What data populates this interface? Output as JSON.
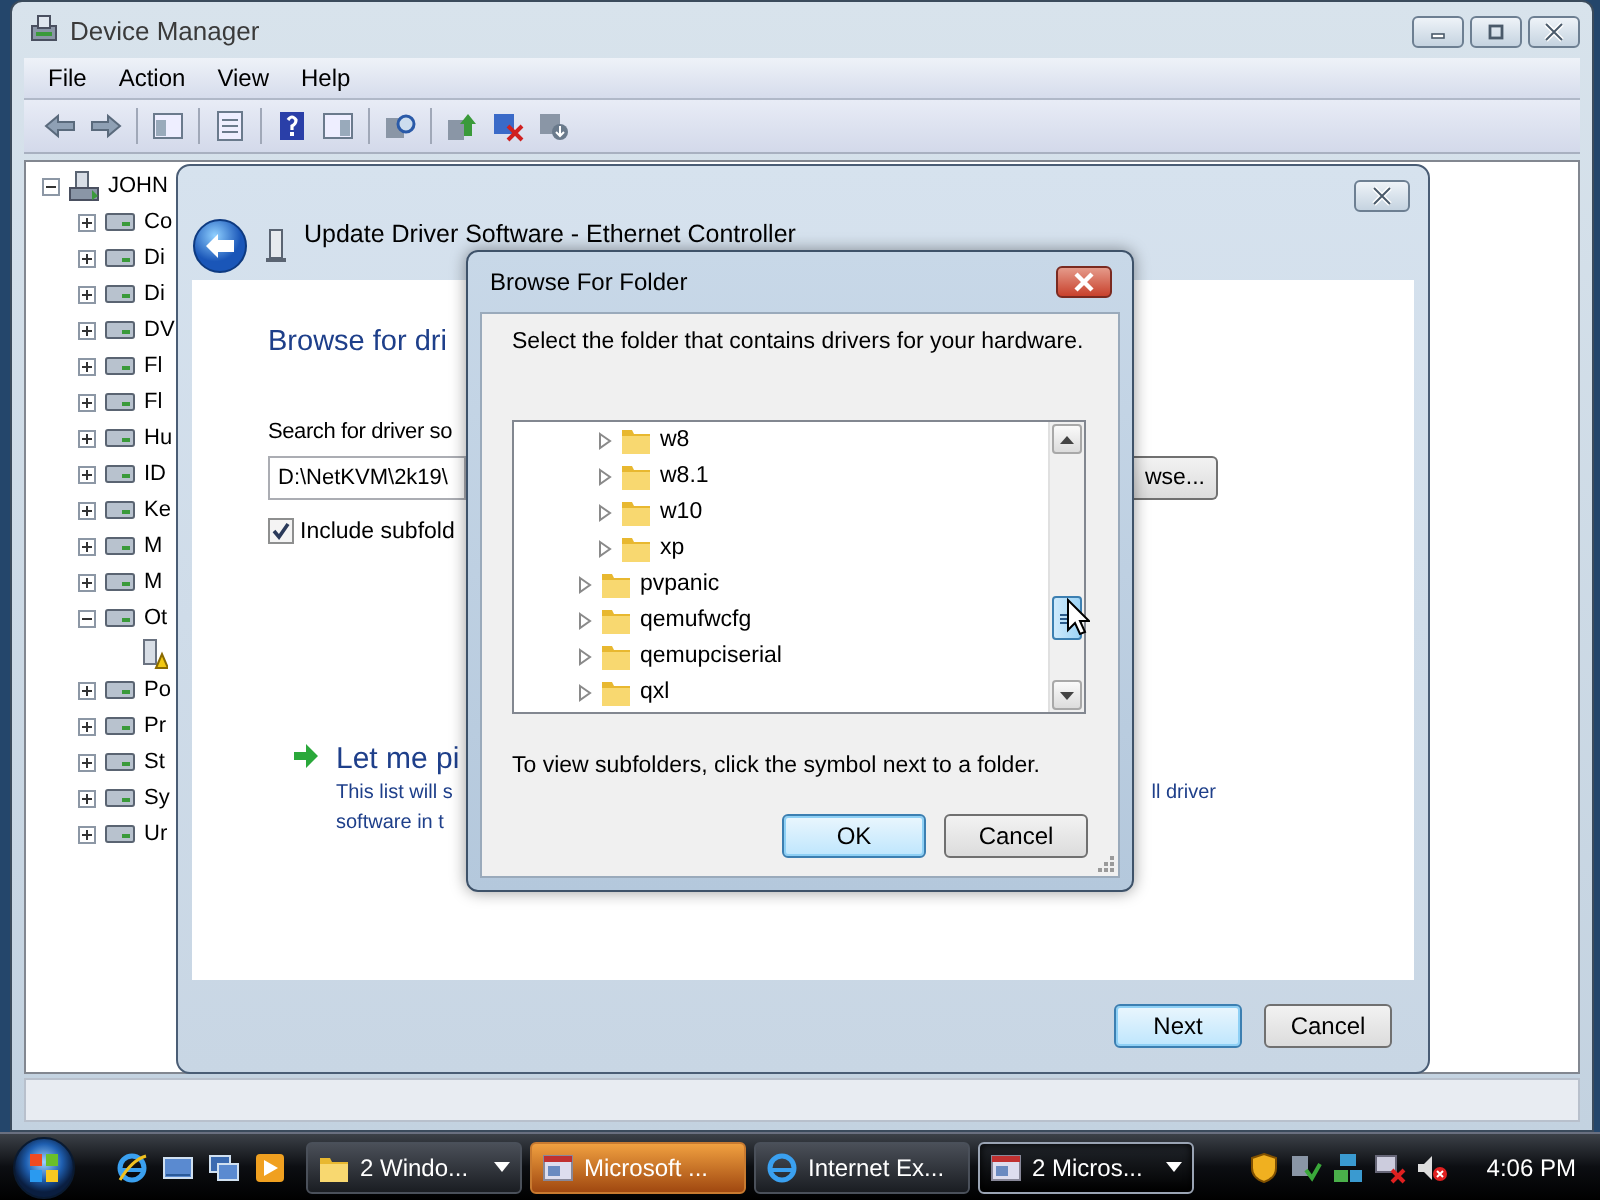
{
  "device_manager": {
    "title": "Device Manager",
    "menu": [
      "File",
      "Action",
      "View",
      "Help"
    ],
    "tree": {
      "label": "JOHN",
      "expanded": true,
      "children": [
        {
          "label": "Co",
          "expanded": false
        },
        {
          "label": "Di",
          "expanded": false
        },
        {
          "label": "Di",
          "expanded": false
        },
        {
          "label": "DV",
          "expanded": false
        },
        {
          "label": "Fl",
          "expanded": false
        },
        {
          "label": "Fl",
          "expanded": false
        },
        {
          "label": "Hu",
          "expanded": false
        },
        {
          "label": "ID",
          "expanded": false
        },
        {
          "label": "Ke",
          "expanded": false
        },
        {
          "label": "M",
          "expanded": false
        },
        {
          "label": "M",
          "expanded": false
        },
        {
          "label": "Ot",
          "expanded": true,
          "children": [
            {
              "warning": true
            }
          ]
        },
        {
          "label": "Po",
          "expanded": false
        },
        {
          "label": "Pr",
          "expanded": false
        },
        {
          "label": "St",
          "expanded": false
        },
        {
          "label": "Sy",
          "expanded": false
        },
        {
          "label": "Ur",
          "expanded": false
        }
      ]
    }
  },
  "update_wizard": {
    "title": "Update Driver Software - Ethernet Controller",
    "heading": "Browse for dri",
    "search_label": "Search for driver so",
    "path_value": "D:\\NetKVM\\2k19\\",
    "browse_button": "wse...",
    "include_subfolders": {
      "label": "Include subfold",
      "checked": true
    },
    "option": {
      "title": "Let me pi",
      "lines": [
        "This list will s",
        "software in t"
      ],
      "right_fragment": "ll driver"
    },
    "buttons": [
      {
        "label": "Next",
        "default": true
      },
      {
        "label": "Cancel",
        "default": false
      }
    ]
  },
  "browse_dialog": {
    "title": "Browse For Folder",
    "instruction": "Select the folder that contains drivers for your hardware.",
    "folders": [
      {
        "children": [
          {
            "label": "w8",
            "expanded": false
          },
          {
            "label": "w8.1",
            "expanded": false
          },
          {
            "label": "w10",
            "expanded": false
          },
          {
            "label": "xp",
            "expanded": false
          }
        ]
      },
      {
        "label": "pvpanic",
        "expanded": false
      },
      {
        "label": "qemufwcfg",
        "expanded": false
      },
      {
        "label": "qemupciserial",
        "expanded": false
      },
      {
        "label": "qxl",
        "expanded": false
      }
    ],
    "footer": "To view subfolders, click the symbol next to a folder.",
    "buttons": [
      {
        "label": "OK",
        "default": true
      },
      {
        "label": "Cancel",
        "default": false
      }
    ]
  },
  "taskbar": {
    "tasks": [
      {
        "label": "2 Windo...",
        "grouped": true,
        "selected": false,
        "flashing": false,
        "kind": "folder"
      },
      {
        "label": "Microsoft ...",
        "grouped": false,
        "selected": false,
        "flashing": true,
        "kind": "app"
      },
      {
        "label": "Internet Ex...",
        "grouped": false,
        "selected": false,
        "flashing": false,
        "kind": "browser"
      },
      {
        "label": "2 Micros...",
        "grouped": true,
        "selected": true,
        "flashing": false,
        "kind": "app"
      }
    ],
    "clock": "4:06 PM"
  }
}
